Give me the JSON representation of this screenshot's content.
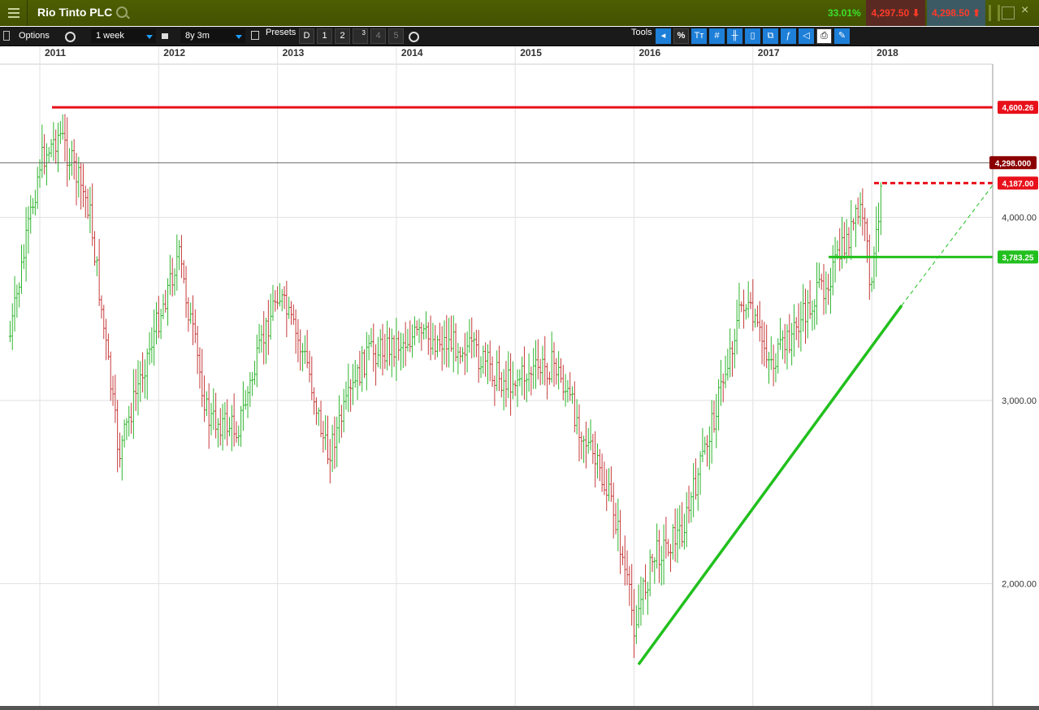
{
  "app": {
    "instrument": "Rio Tinto PLC",
    "change_pct": "33.01%",
    "sell_price": "4,297.50",
    "buy_price": "4,298.50"
  },
  "toolbar": {
    "options_label": "Options",
    "interval": "1 week",
    "range": "8y 3m",
    "presets_label": "Presets",
    "preset_d": "D",
    "preset_1": "1",
    "preset_2": "2",
    "preset_3": "3",
    "preset_4": "4",
    "preset_5": "5",
    "tools_label": "Tools",
    "percent_label": "%",
    "text_tool_label": "Tт"
  },
  "colors": {
    "up": "#2fb52f",
    "down": "#c73a3a",
    "resistance": "#e8101a",
    "support": "#22c01e",
    "price_badge": "#8b0000"
  },
  "chart_data": {
    "type": "ohlc",
    "interval": "weekly",
    "x_labels": [
      "2011",
      "2012",
      "2013",
      "2014",
      "2015",
      "2016",
      "2017",
      "2018"
    ],
    "y_ticks": [
      "2,000.00",
      "3,000.00",
      "4,000.00"
    ],
    "ylim": [
      1550,
      4950
    ],
    "annotations": {
      "resistance_high": {
        "value": 4600.26,
        "label": "4,600.26"
      },
      "current_price": {
        "value": 4298.0,
        "label": "4,298.000"
      },
      "resistance_recent": {
        "value": 4187.0,
        "label": "4,187.00"
      },
      "support": {
        "value": 3783.25,
        "label": "3,783.25"
      }
    },
    "anchors": [
      {
        "x": "2010-10",
        "y": 3350
      },
      {
        "x": "2011-01",
        "y": 4300
      },
      {
        "x": "2011-03",
        "y": 4460
      },
      {
        "x": "2011-06",
        "y": 4050
      },
      {
        "x": "2011-08",
        "y": 3150
      },
      {
        "x": "2011-09",
        "y": 2700
      },
      {
        "x": "2011-11",
        "y": 3100
      },
      {
        "x": "2012-03",
        "y": 3800
      },
      {
        "x": "2012-06",
        "y": 2900
      },
      {
        "x": "2012-09",
        "y": 2850
      },
      {
        "x": "2013-01",
        "y": 3600
      },
      {
        "x": "2013-04",
        "y": 3200
      },
      {
        "x": "2013-06",
        "y": 2700
      },
      {
        "x": "2013-10",
        "y": 3250
      },
      {
        "x": "2014-03",
        "y": 3350
      },
      {
        "x": "2014-08",
        "y": 3300
      },
      {
        "x": "2014-12",
        "y": 3100
      },
      {
        "x": "2015-05",
        "y": 3200
      },
      {
        "x": "2015-08",
        "y": 2800
      },
      {
        "x": "2015-11",
        "y": 2400
      },
      {
        "x": "2016-01",
        "y": 1780
      },
      {
        "x": "2016-03",
        "y": 2150
      },
      {
        "x": "2016-06",
        "y": 2300
      },
      {
        "x": "2016-09",
        "y": 2900
      },
      {
        "x": "2016-12",
        "y": 3550
      },
      {
        "x": "2017-03",
        "y": 3200
      },
      {
        "x": "2017-06",
        "y": 3450
      },
      {
        "x": "2017-09",
        "y": 3700
      },
      {
        "x": "2017-12",
        "y": 4050
      },
      {
        "x": "2018-01",
        "y": 3600
      },
      {
        "x": "2018-02",
        "y": 4250
      }
    ]
  }
}
